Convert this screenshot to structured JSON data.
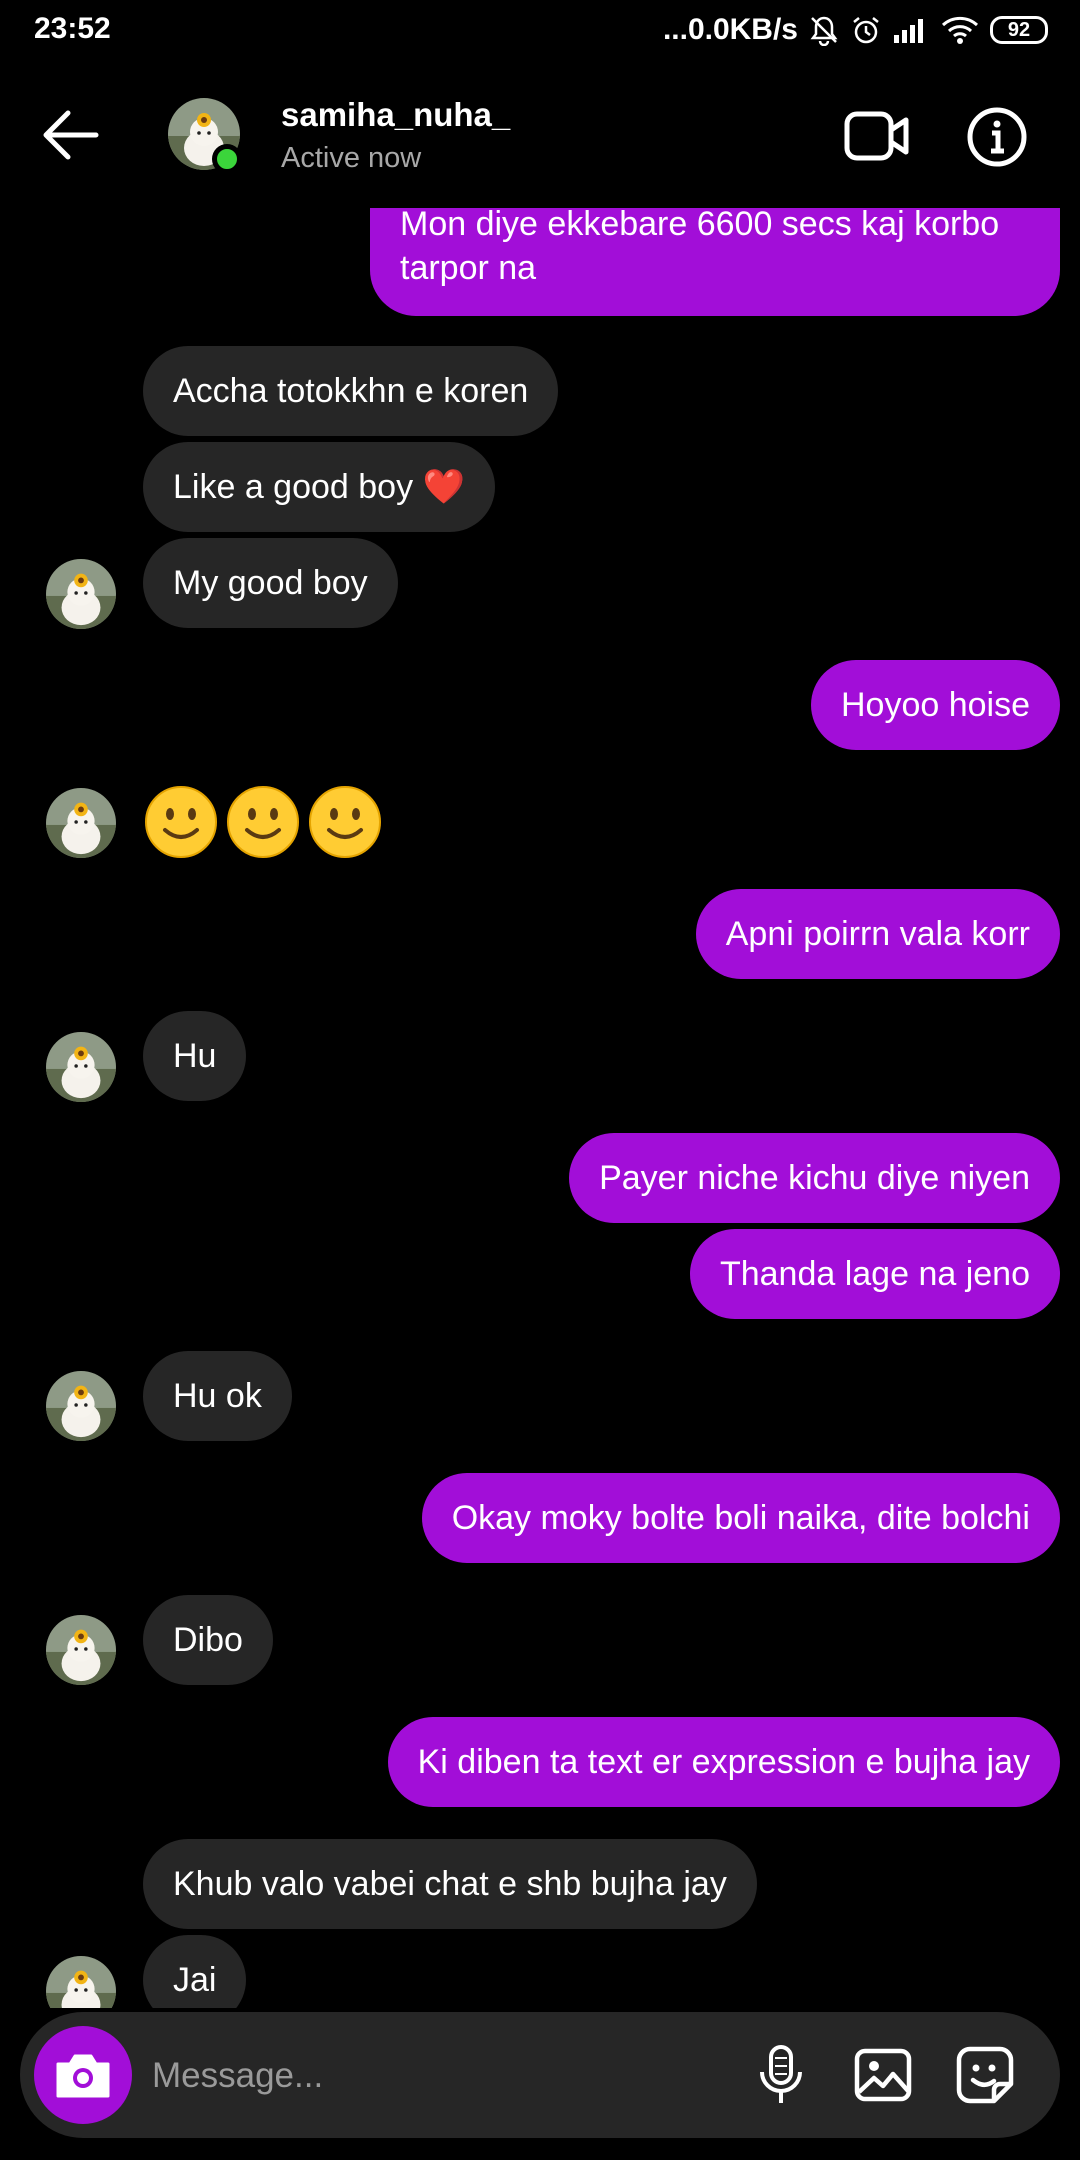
{
  "status_bar": {
    "time": "23:52",
    "network_speed": "...0.0KB/s",
    "battery": "92",
    "icons": [
      "dots-icon",
      "mute-icon",
      "alarm-icon",
      "signal-icon",
      "wifi-icon",
      "battery-icon"
    ]
  },
  "header": {
    "username": "samiha_nuha_",
    "status": "Active now",
    "icons": [
      "back-arrow-icon",
      "video-call-icon",
      "info-icon"
    ]
  },
  "messages": [
    {
      "side": "out",
      "text": "Mon diye ekkebare 6600 secs kaj korbo\ntarpor na"
    },
    {
      "side": "in",
      "text": "Accha totokkhn e koren"
    },
    {
      "side": "in",
      "text": "Like a good boy ❤️"
    },
    {
      "side": "in",
      "text": "My good boy"
    },
    {
      "side": "out",
      "text": "Hoyoo hoise"
    },
    {
      "side": "in",
      "text": "🙂🙂🙂"
    },
    {
      "side": "out",
      "text": "Apni poirrn vala korr"
    },
    {
      "side": "in",
      "text": "Hu"
    },
    {
      "side": "out",
      "text": "Payer niche kichu diye niyen"
    },
    {
      "side": "out",
      "text": "Thanda lage na jeno"
    },
    {
      "side": "in",
      "text": "Hu ok"
    },
    {
      "side": "out",
      "text": "Okay moky bolte boli naika, dite bolchi"
    },
    {
      "side": "in",
      "text": "Dibo"
    },
    {
      "side": "out",
      "text": "Ki diben ta text er expression e bujha jay"
    },
    {
      "side": "in",
      "text": "Khub valo vabei chat e shb bujha jay"
    },
    {
      "side": "in",
      "text": "Jai"
    }
  ],
  "composer": {
    "placeholder": "Message...",
    "icons": [
      "camera-icon",
      "microphone-icon",
      "gallery-icon",
      "sticker-icon"
    ]
  },
  "colors": {
    "background": "#000000",
    "outgoing_bubble": "#a20ed8",
    "incoming_bubble": "#262626",
    "online_indicator": "#3bd53b",
    "secondary_text": "#a8a8a8"
  }
}
